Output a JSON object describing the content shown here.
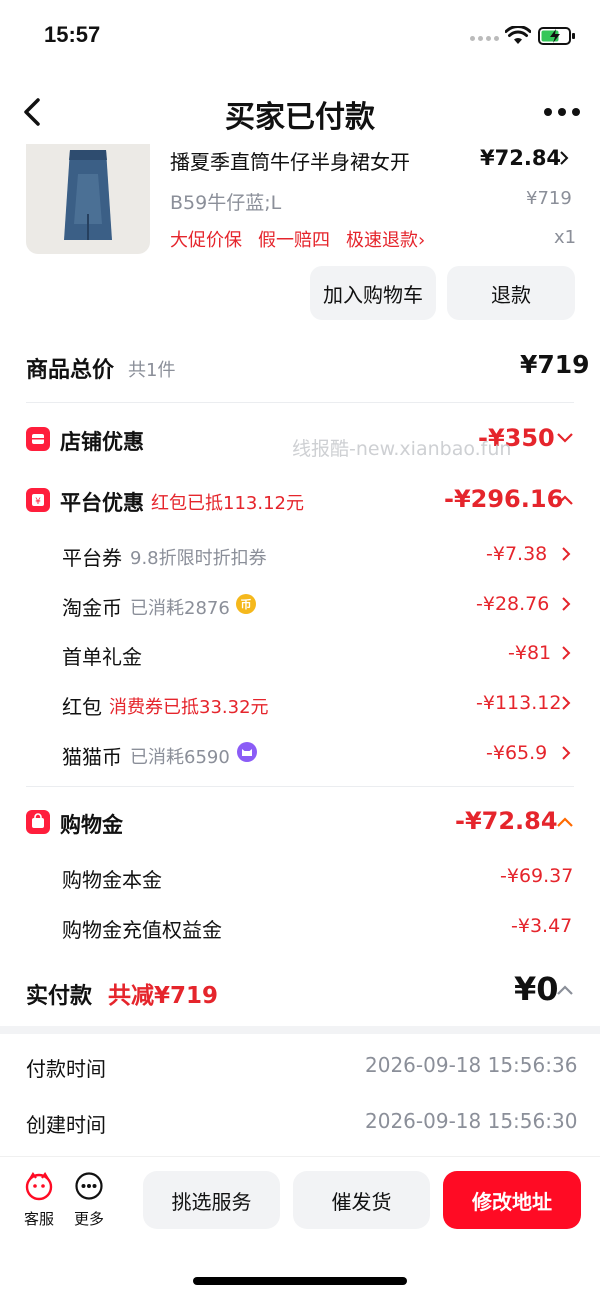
{
  "status": {
    "time": "15:57"
  },
  "nav": {
    "title": "买家已付款"
  },
  "product": {
    "title": "播夏季直筒牛仔半身裙女开",
    "price": "¥72.84",
    "sku": "B59牛仔蓝;L",
    "original_price": "¥719",
    "tags": [
      "大促价保",
      "假一赔四",
      "极速退款›"
    ],
    "qty": "x1",
    "add_cart_label": "加入购物车",
    "refund_label": "退款"
  },
  "totals": {
    "label": "商品总价",
    "count": "共1件",
    "value": "¥719"
  },
  "watermark": "线报酷-new.xianbao.fun",
  "store_discount": {
    "label": "店铺优惠",
    "amount": "-¥350"
  },
  "platform_discount": {
    "label": "平台优惠",
    "note": "红包已抵113.12元",
    "amount": "-¥296.16",
    "rows": [
      {
        "label": "平台券",
        "note": "9.8折限时折扣券",
        "amount": "-¥7.38"
      },
      {
        "label": "淘金币",
        "note": "已消耗2876",
        "amount": "-¥28.76",
        "badge": "币"
      },
      {
        "label": "首单礼金",
        "note": "",
        "amount": "-¥81"
      },
      {
        "label": "红包",
        "note": "消费券已抵33.32元",
        "amount": "-¥113.12"
      },
      {
        "label": "猫猫币",
        "note": "已消耗6590",
        "amount": "-¥65.9"
      }
    ]
  },
  "shopping_credit": {
    "label": "购物金",
    "amount": "-¥72.84",
    "rows": [
      {
        "label": "购物金本金",
        "amount": "-¥69.37"
      },
      {
        "label": "购物金充值权益金",
        "amount": "-¥3.47"
      }
    ]
  },
  "payment": {
    "label": "实付款",
    "reduce": "共减¥719",
    "value": "¥0"
  },
  "info": [
    {
      "label": "付款时间",
      "value": "2026-09-18 15:56:36"
    },
    {
      "label": "创建时间",
      "value": "2026-09-18 15:56:30"
    }
  ],
  "bottom": {
    "service_label": "客服",
    "more_label": "更多",
    "pick_service": "挑选服务",
    "urge_ship": "催发货",
    "change_address": "修改地址"
  },
  "colors": {
    "accent": "#ff0b24",
    "discount": "#e5252c",
    "muted": "#8b8f99"
  }
}
